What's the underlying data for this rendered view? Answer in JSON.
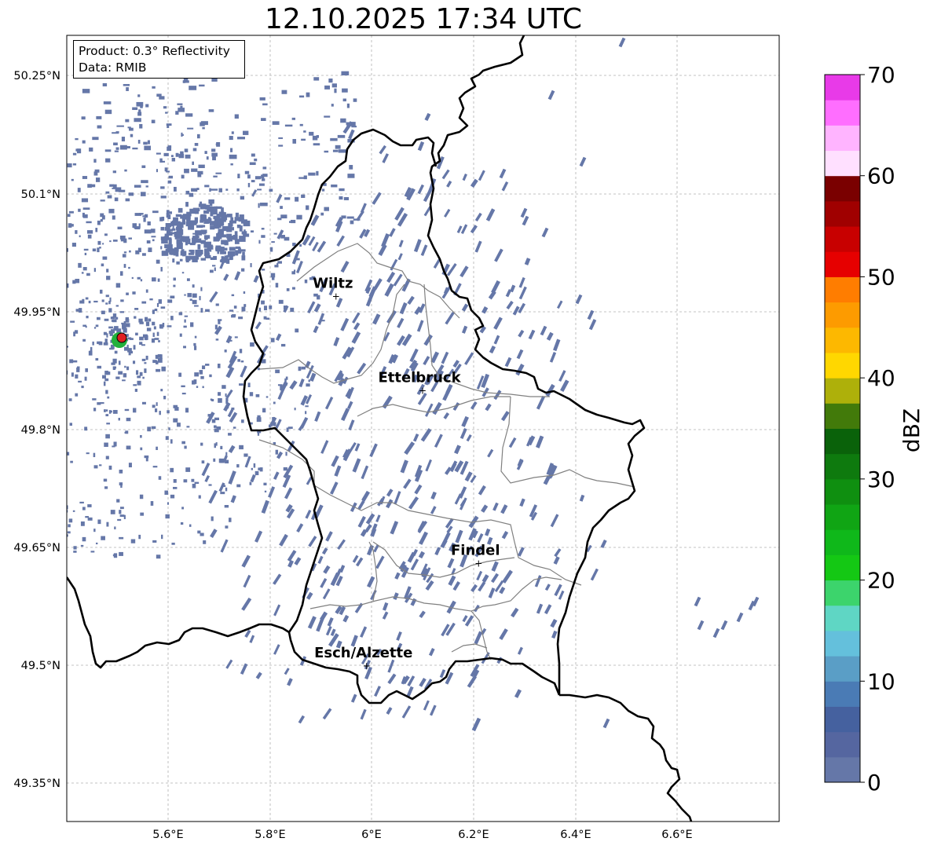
{
  "title": "12.10.2025 17:34 UTC",
  "info_box": {
    "product": "Product: 0.3° Reflectivity",
    "source": "Data: RMIB"
  },
  "axes": {
    "lat_labels": [
      "50.25°N",
      "50.1°N",
      "49.95°N",
      "49.8°N",
      "49.65°N",
      "49.5°N",
      "49.35°N"
    ],
    "lon_labels": [
      "5.6°E",
      "5.8°E",
      "6°E",
      "6.2°E",
      "6.4°E",
      "6.6°E"
    ]
  },
  "cities": [
    {
      "name": "Wiltz",
      "lon": 5.93,
      "lat": 49.97
    },
    {
      "name": "Ettelbruck",
      "lon": 6.1,
      "lat": 49.85
    },
    {
      "name": "Findel",
      "lon": 6.21,
      "lat": 49.63
    },
    {
      "name": "Esch/Alzette",
      "lon": 5.99,
      "lat": 49.5
    }
  ],
  "radar_site": {
    "lon": 5.51,
    "lat": 49.92
  },
  "colorbar": {
    "unit": "dBZ",
    "ticks": [
      "0",
      "10",
      "20",
      "30",
      "40",
      "50",
      "60",
      "70"
    ],
    "colors": [
      "#6577a8",
      "#5566a0",
      "#45619f",
      "#4a7bb5",
      "#5a9ec6",
      "#64c0dc",
      "#5fd6c4",
      "#3cd46c",
      "#14c814",
      "#0fb81a",
      "#10a514",
      "#0f8f10",
      "#0e7a0e",
      "#0a620a",
      "#427a0a",
      "#aeb00a",
      "#ffd700",
      "#fdb800",
      "#fd9b00",
      "#ff7d00",
      "#e60000",
      "#c80000",
      "#a00000",
      "#7a0000",
      "#ffe0ff",
      "#ffb4ff",
      "#ff6eff",
      "#e83ae8"
    ]
  },
  "echo_color": "#6577a8"
}
